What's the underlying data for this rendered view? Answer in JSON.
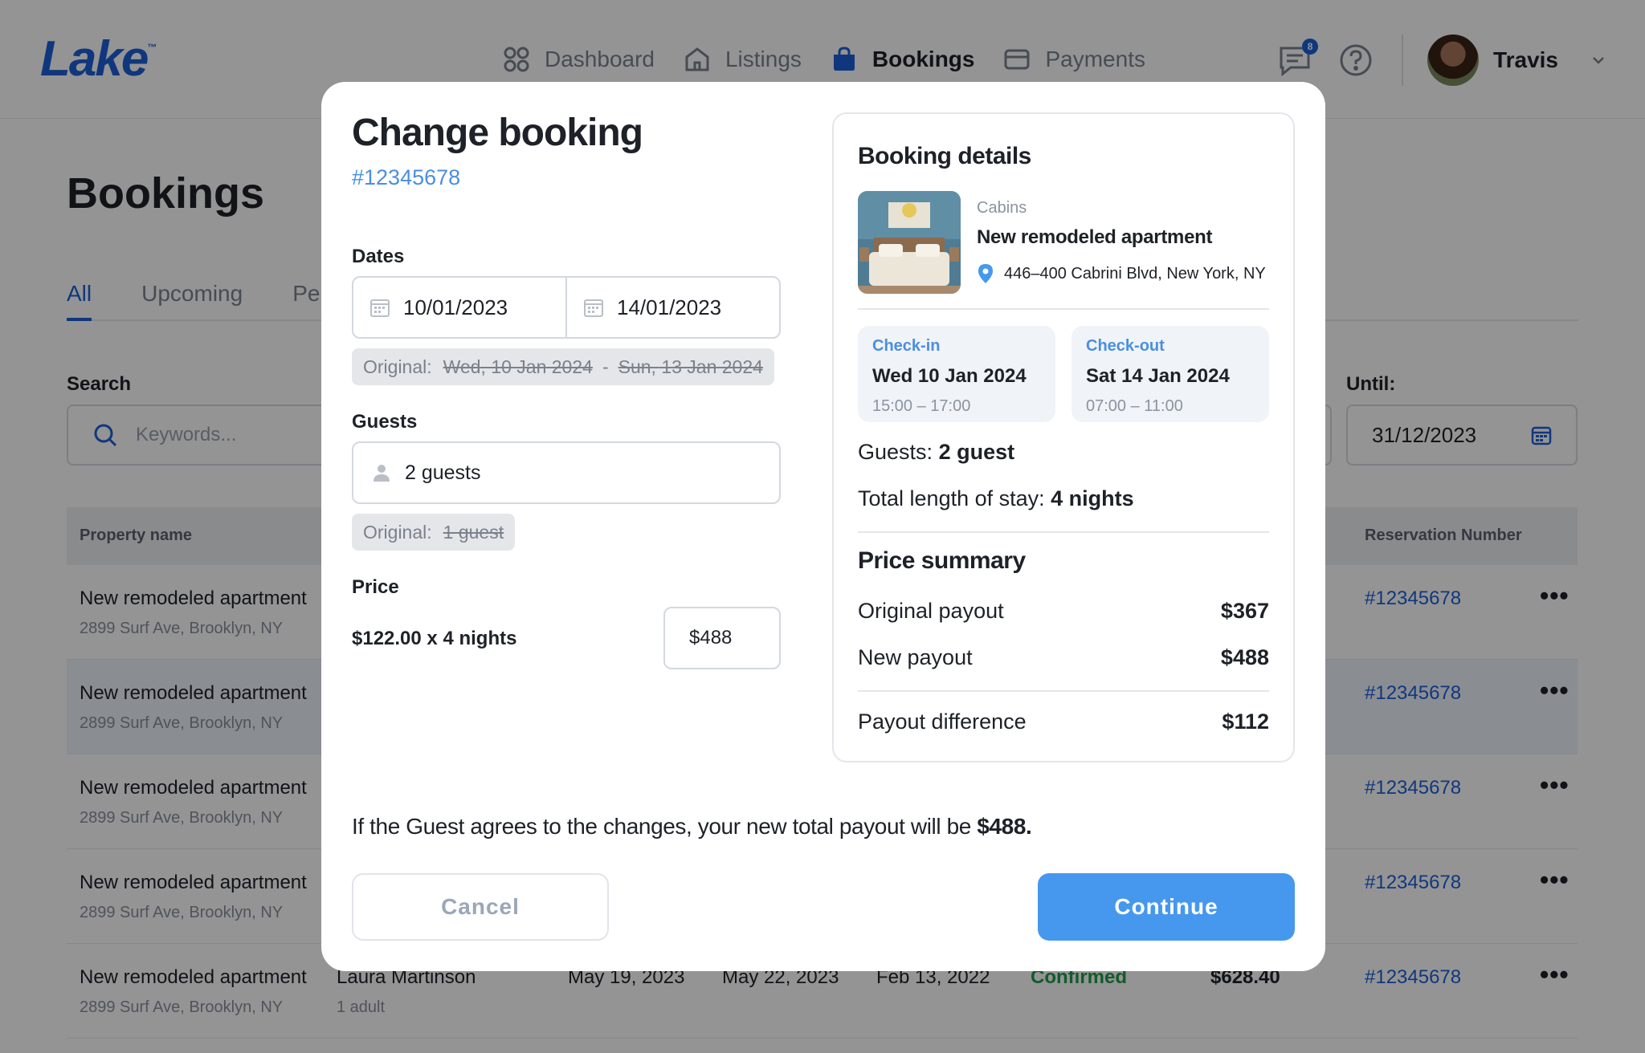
{
  "app": {
    "logo": "Lake",
    "logo_tm": "™"
  },
  "nav": {
    "dashboard": "Dashboard",
    "listings": "Listings",
    "bookings": "Bookings",
    "payments": "Payments"
  },
  "header": {
    "messages_badge": "8",
    "user_name": "Travis"
  },
  "page": {
    "title": "Bookings",
    "tabs": [
      "All",
      "Upcoming",
      "Pe"
    ],
    "search_label": "Search",
    "search_placeholder": "Keywords...",
    "until_label": "Until:",
    "until_value": "31/12/2023"
  },
  "table": {
    "headers": {
      "property": "Property name",
      "reservation": "Reservation Number"
    },
    "rows": [
      {
        "name": "New remodeled apartment",
        "address": "2899 Surf Ave, Brooklyn, NY",
        "reservation": "#12345678",
        "dots": "•••"
      },
      {
        "name": "New remodeled apartment",
        "address": "2899 Surf Ave, Brooklyn, NY",
        "reservation": "#12345678",
        "dots": "•••"
      },
      {
        "name": "New remodeled apartment",
        "address": "2899 Surf Ave, Brooklyn, NY",
        "reservation": "#12345678",
        "dots": "•••"
      },
      {
        "name": "New remodeled apartment",
        "address": "2899 Surf Ave, Brooklyn, NY",
        "reservation": "#12345678",
        "dots": "•••"
      },
      {
        "name": "New remodeled apartment",
        "address": "2899 Surf Ave, Brooklyn, NY",
        "guest": "Laura Martinson",
        "guest_sub": "1 adult",
        "checkin": "May 19, 2023",
        "checkout": "May 22, 2023",
        "booked": "Feb 13, 2022",
        "status": "Confirmed",
        "price": "$628.40",
        "reservation": "#12345678",
        "dots": "•••"
      }
    ]
  },
  "modal": {
    "title": "Change booking",
    "booking_id": "#12345678",
    "dates_label": "Dates",
    "date_from": "10/01/2023",
    "date_to": "14/01/2023",
    "dates_original_label": "Original:",
    "dates_original_from": "Wed, 10 Jan 2024",
    "dates_original_sep": "-",
    "dates_original_to": "Sun, 13 Jan 2024",
    "guests_label": "Guests",
    "guests_value": "2 guests",
    "guests_original_label": "Original:",
    "guests_original": "1 guest",
    "price_label": "Price",
    "price_calc": "$122.00 x 4 nights",
    "price_value": "$488",
    "note_prefix": "If the Guest agrees to the changes, your new total payout will be ",
    "note_amount": "$488.",
    "cancel_label": "Cancel",
    "continue_label": "Continue"
  },
  "details": {
    "title": "Booking details",
    "category": "Cabins",
    "property": "New remodeled apartment",
    "address": "446–400 Cabrini Blvd, New York, NY",
    "checkin_label": "Check-in",
    "checkin_date": "Wed 10 Jan 2024",
    "checkin_time": "15:00 – 17:00",
    "checkout_label": "Check-out",
    "checkout_date": "Sat 14 Jan 2024",
    "checkout_time": "07:00 – 11:00",
    "guests_label": "Guests:",
    "guests_value": "2 guest",
    "stay_label": "Total length of stay:",
    "stay_value": "4 nights",
    "price_summary_title": "Price summary",
    "original_payout_label": "Original payout",
    "original_payout_value": "$367",
    "new_payout_label": "New payout",
    "new_payout_value": "$488",
    "difference_label": "Payout difference",
    "difference_value": "$112"
  },
  "colors": {
    "accent": "#4598ee",
    "brand": "#1d5fd8",
    "link": "#4a8fe0",
    "status_confirmed": "#1f9d4a"
  },
  "icons": {
    "nav": [
      "grid-icon",
      "home-icon",
      "bag-icon",
      "card-icon"
    ],
    "header": [
      "chat-icon",
      "help-icon",
      "chevron-down-icon"
    ],
    "fields": [
      "calendar-icon",
      "user-icon",
      "search-icon",
      "location-pin-icon"
    ]
  }
}
